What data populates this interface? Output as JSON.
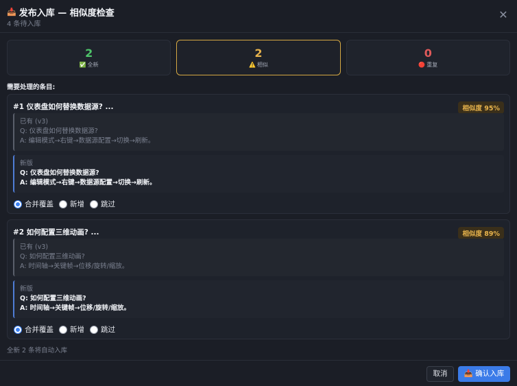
{
  "header": {
    "title_icon": "📥",
    "title": "发布入库 — 相似度检查",
    "subtitle": "4 条待入库",
    "close_glyph": "✕"
  },
  "stats": [
    {
      "value": "2",
      "icon": "✅",
      "label": "全新",
      "color": "#4ec46a"
    },
    {
      "value": "2",
      "icon": "⚠️",
      "label": "相似",
      "color": "#e7b34c"
    },
    {
      "value": "0",
      "icon": "🔴",
      "label": "重复",
      "color": "#e05a5a"
    }
  ],
  "section_label": "需要处理的条目:",
  "items": [
    {
      "heading": "#1 仪表盘如何替换数据源? ...",
      "similarity": "相似度 95%",
      "old": {
        "tag": "已有 (v3)",
        "q": "Q: 仪表盘如何替换数据源?",
        "a": "A: 编辑模式→右键→数据源配置→切换→刷新。"
      },
      "new": {
        "tag": "新版",
        "q": "Q: 仪表盘如何替换数据源?",
        "a": "A: 编辑模式→右键→数据源配置→切换→刷新。"
      },
      "options": [
        "合并覆盖",
        "新增",
        "跳过"
      ],
      "selected": 0
    },
    {
      "heading": "#2 如何配置三维动画? ...",
      "similarity": "相似度 89%",
      "old": {
        "tag": "已有 (v3)",
        "q": "Q: 如何配置三维动画?",
        "a": "A: 时间轴→关键帧→位移/旋转/缩放。"
      },
      "new": {
        "tag": "新版",
        "q": "Q: 如何配置三维动画?",
        "a": "A: 时间轴→关键帧→位移/旋转/缩放。"
      },
      "options": [
        "合并覆盖",
        "新增",
        "跳过"
      ],
      "selected": 0
    }
  ],
  "footer_note": "全新 2 条将自动入库",
  "buttons": {
    "cancel": "取消",
    "confirm_icon": "📥",
    "confirm": "确认入库"
  },
  "colors": {
    "accent": "#3b7be8",
    "warning": "#e7b34c"
  }
}
